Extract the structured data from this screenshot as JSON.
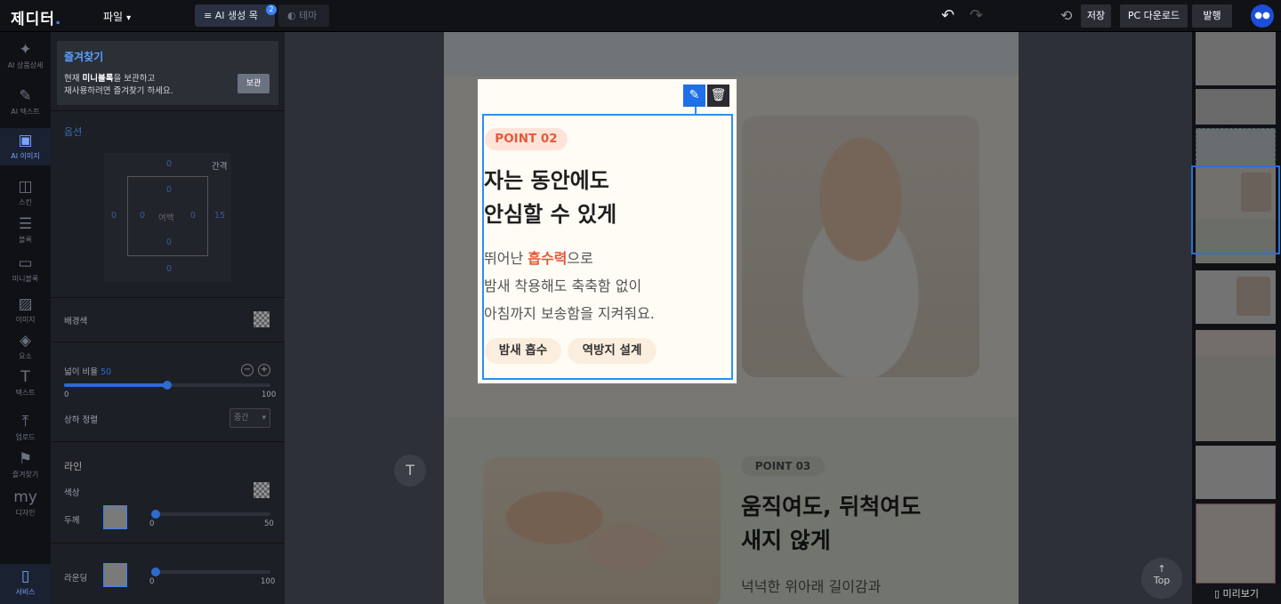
{
  "app": {
    "logo": "제디터",
    "logo_dot": "."
  },
  "topbar": {
    "file_menu": "파일",
    "ai_tab": "AI 생성 목록",
    "ai_badge": "2",
    "theme_tab": "테마",
    "save": "저장",
    "pc_download": "PC 다운로드",
    "publish": "발행",
    "undo_icon": "undo-icon",
    "redo_icon": "redo-icon"
  },
  "rail": [
    {
      "label": "AI 상품상세",
      "glyph": "✦"
    },
    {
      "label": "AI 텍스트",
      "glyph": "✎"
    },
    {
      "label": "AI 이미지",
      "glyph": "▣"
    },
    {
      "label": "스킨",
      "glyph": "◫"
    },
    {
      "label": "블록",
      "glyph": "☰"
    },
    {
      "label": "미니블록",
      "glyph": "▭"
    },
    {
      "label": "이미지",
      "glyph": "▨"
    },
    {
      "label": "요소",
      "glyph": "◈"
    },
    {
      "label": "텍스트",
      "glyph": "T"
    },
    {
      "label": "업로드",
      "glyph": "⤒"
    },
    {
      "label": "즐겨찾기",
      "glyph": "⚑"
    },
    {
      "label": "디자인",
      "glyph": "my"
    },
    {
      "label": "서비스",
      "glyph": "▯"
    }
  ],
  "favorites": {
    "title": "즐겨찾기",
    "desc_prefix": "현재 ",
    "desc_bold": "미니블록",
    "desc_suffix": "을 보관하고",
    "desc_line2": "재사용하려면 즐겨찾기 하세요.",
    "button": "보관"
  },
  "options": {
    "title": "옵션",
    "gap_label": "간격",
    "padding_label": "여백",
    "outer": {
      "top": "0",
      "left": "0",
      "right": "15",
      "bottom": "0"
    },
    "inner": {
      "top": "0",
      "left": "0",
      "right": "0",
      "bottom": "0"
    }
  },
  "background": {
    "label": "배경색"
  },
  "width_ratio": {
    "label": "넓이 비율",
    "value": 50,
    "min": "0",
    "max": "100",
    "display": "50"
  },
  "vertical_align": {
    "label": "상하 정렬",
    "value": "중간"
  },
  "line": {
    "title": "라인",
    "color_label": "색상",
    "thickness_label": "두께",
    "thickness_min": "0",
    "thickness_max": "50",
    "thickness_value": 0
  },
  "rounding": {
    "label": "라운딩",
    "min": "0",
    "max": "100",
    "value": 0
  },
  "card": {
    "point": "POINT 02",
    "heading1": "자는 동안에도",
    "heading2": "안심할 수 있게",
    "body1_prefix": "뛰어난 ",
    "body1_highlight": "흡수력",
    "body1_suffix": "으로",
    "body2": "밤새 착용해도 축축함 없이",
    "body3": "아침까지 보송함을 지켜줘요.",
    "tag1": "밤새 흡수",
    "tag2": "역방지 설계",
    "edit_icon": "pencil-icon",
    "delete_icon": "trash-icon"
  },
  "section3": {
    "point": "POINT 03",
    "heading1": "움직여도, 뒤척여도",
    "heading2": "새지 않게",
    "body": "넉넉한 위아래 길이감과"
  },
  "floating": {
    "top": "Top",
    "top_arrow": "↑",
    "text_tool": "T"
  },
  "minimap": {
    "preview": "미리보기"
  },
  "colors": {
    "accent": "#2b8ff0",
    "highlight": "#e35b3a",
    "point_pill": "#fde4d9"
  }
}
